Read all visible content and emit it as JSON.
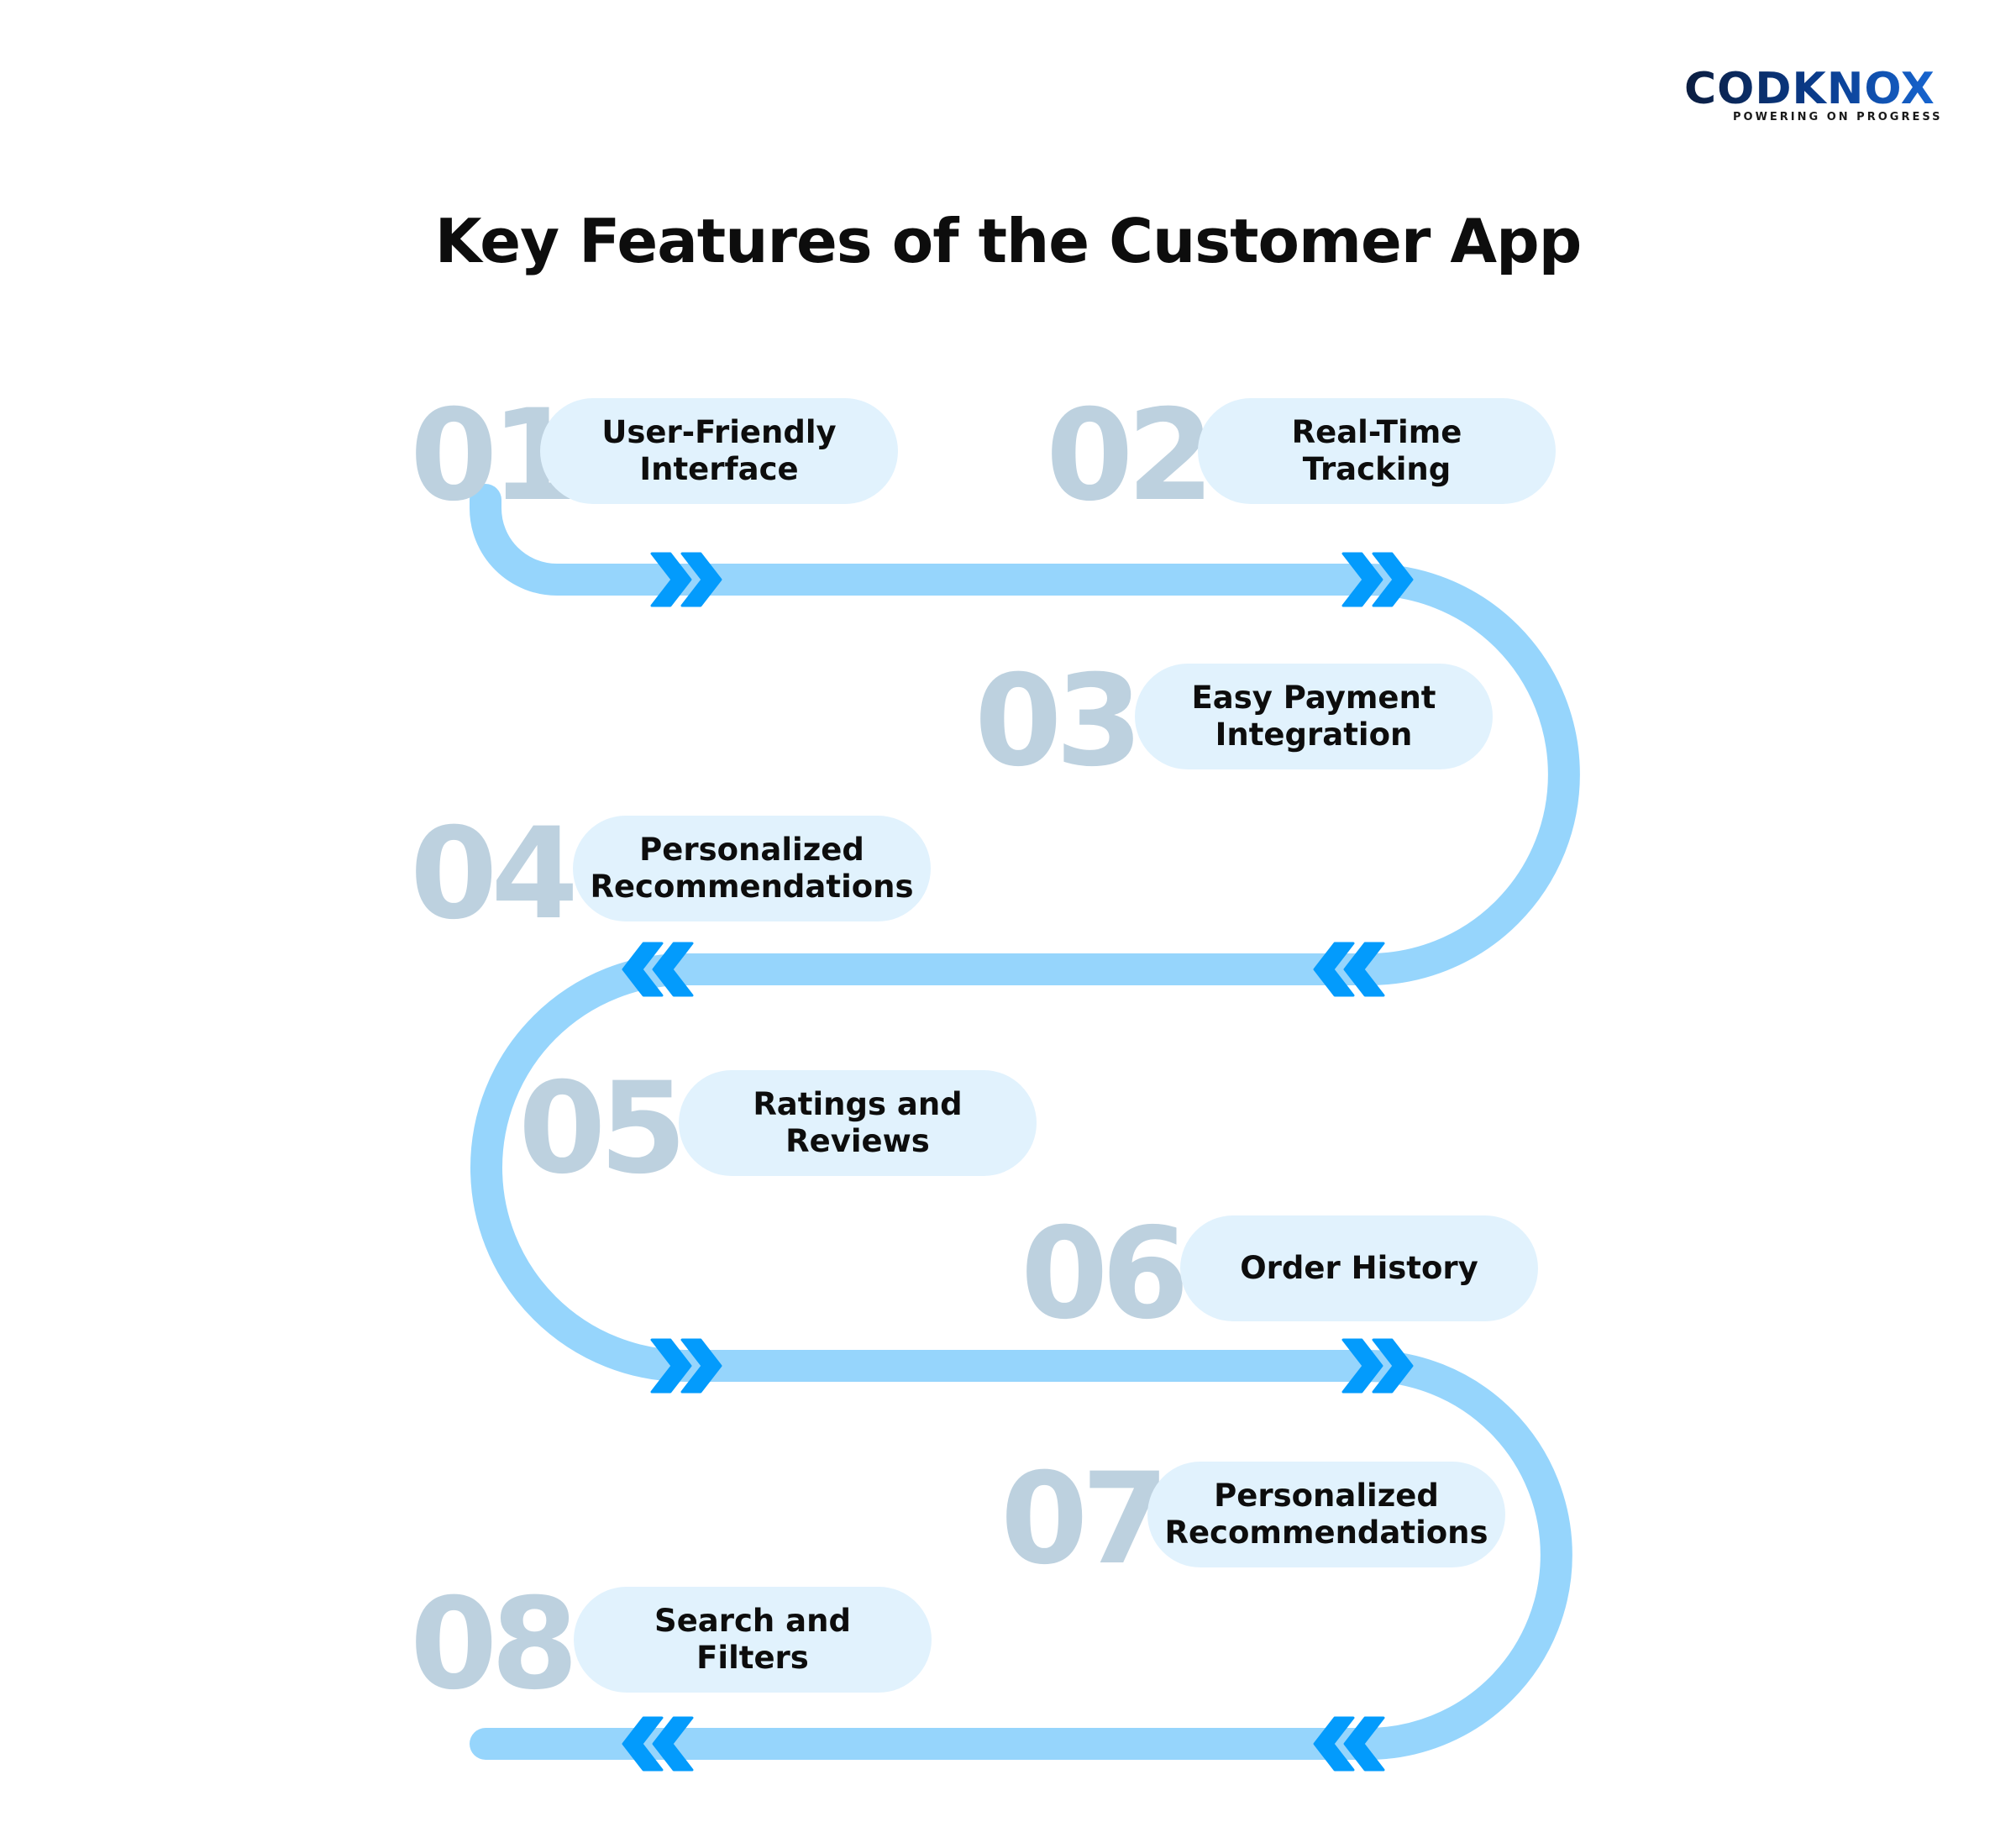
{
  "logo": {
    "name": "CODKNOX",
    "tagline": "POWERING ON PROGRESS"
  },
  "title": "Key Features of the Customer App",
  "colors": {
    "path": "#96D5FC",
    "chevron": "#039BFC",
    "number": "#BDD1DF",
    "pill": "#E1F2FD",
    "text": "#0D0D0D"
  },
  "features": [
    {
      "number": "01",
      "label": "User-Friendly\nInterface"
    },
    {
      "number": "02",
      "label": "Real-Time\nTracking"
    },
    {
      "number": "03",
      "label": "Easy Payment\nIntegration"
    },
    {
      "number": "04",
      "label": "Personalized\nRecommendations"
    },
    {
      "number": "05",
      "label": "Ratings and\nReviews"
    },
    {
      "number": "06",
      "label": "Order History"
    },
    {
      "number": "07",
      "label": "Personalized\nRecommendations"
    },
    {
      "number": "08",
      "label": "Search and\nFilters"
    }
  ],
  "flow_arrows": [
    {
      "row": 1,
      "direction": "right"
    },
    {
      "row": 2,
      "direction": "left"
    },
    {
      "row": 3,
      "direction": "right"
    },
    {
      "row": 4,
      "direction": "left"
    }
  ]
}
